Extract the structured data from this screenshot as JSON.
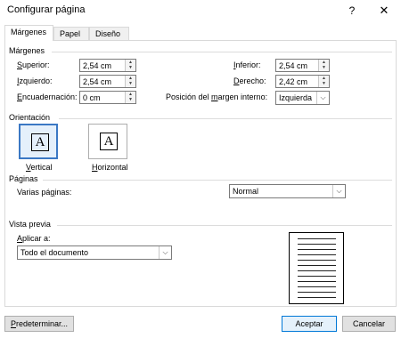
{
  "window": {
    "title": "Configurar página",
    "help": "?",
    "close": "✕"
  },
  "tabs": [
    {
      "label": "Márgenes",
      "active": true
    },
    {
      "label": "Papel"
    },
    {
      "label": "Diseño"
    }
  ],
  "margins": {
    "heading": "Márgenes",
    "superior": {
      "label_u": "S",
      "label_rest": "uperior:",
      "value": "2,54 cm"
    },
    "izquierdo": {
      "label_u": "I",
      "label_rest": "zquierdo:",
      "value": "2,54 cm"
    },
    "encuadernacion": {
      "label_u": "E",
      "label_rest": "ncuadernación:",
      "value": "0 cm"
    },
    "inferior": {
      "label_u": "I",
      "label_rest": "nferior:",
      "value": "2,54 cm"
    },
    "derecho": {
      "label_u": "D",
      "label_rest": "erecho:",
      "value": "2,42 cm"
    },
    "posicion": {
      "label_a": "Posición del ",
      "label_u": "m",
      "label_b": "argen interno:",
      "value": "Izquierda"
    }
  },
  "orientation": {
    "heading": "Orientación",
    "vertical": {
      "glyph": "A",
      "label_u": "V",
      "label_rest": "ertical",
      "selected": true
    },
    "horizontal": {
      "glyph": "A",
      "label_u": "H",
      "label_rest": "orizontal"
    }
  },
  "pages": {
    "heading": "Páginas",
    "label_a": "Varias pá",
    "label_u": "g",
    "label_b": "inas:",
    "value": "Normal"
  },
  "preview": {
    "heading": "Vista previa",
    "apply_u": "A",
    "apply_rest": "plicar a:",
    "apply_value": "Todo el documento"
  },
  "footer": {
    "default_u": "P",
    "default_rest": "redeterminar...",
    "ok": "Aceptar",
    "cancel": "Cancelar"
  },
  "colors": {
    "accent": "#0078d7",
    "selected_border": "#3b78c4"
  }
}
